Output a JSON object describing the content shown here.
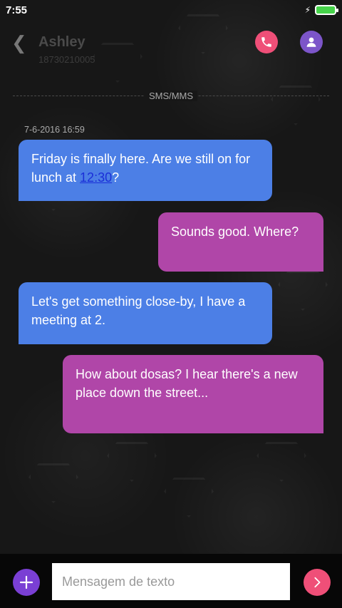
{
  "status": {
    "time": "7:55"
  },
  "header": {
    "name": "Ashley",
    "number": "18730210005"
  },
  "channel_label": "SMS/MMS",
  "timestamp": "7-6-2016 16:59",
  "messages": [
    {
      "direction": "in",
      "text_before": "Friday is finally here. Are we still on for lunch at ",
      "link": "12:30",
      "text_after": "?"
    },
    {
      "direction": "out",
      "text": "Sounds good. Where?"
    },
    {
      "direction": "in",
      "text": "Let's get something close-by, I have a meeting at 2."
    },
    {
      "direction": "out",
      "text": "How about dosas? I hear there's a new place down the street..."
    }
  ],
  "composer": {
    "placeholder": "Mensagem de texto"
  },
  "colors": {
    "incoming": "#4c7fe6",
    "outgoing": "#b046a8",
    "accent_pink": "#ef4f78",
    "accent_purple": "#7c55c9"
  },
  "icons": {
    "back": "back-arrow-icon",
    "call": "phone-icon",
    "contact": "person-icon",
    "add": "plus-icon",
    "send": "chevron-right-icon"
  }
}
